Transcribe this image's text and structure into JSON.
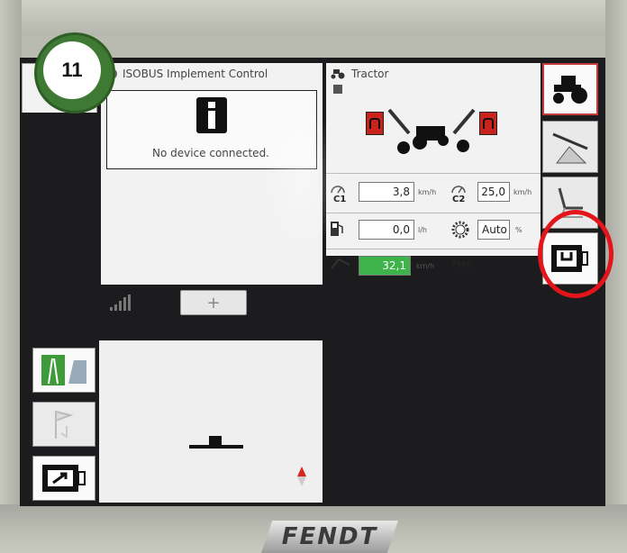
{
  "step_badge": "11",
  "isobus": {
    "title": "ISOBUS Implement Control",
    "message": "No device connected.",
    "plus_label": "+"
  },
  "tractor": {
    "title": "Tractor",
    "c1": {
      "label": "C1",
      "value": "3,8",
      "unit": "km/h"
    },
    "c2": {
      "label": "C2",
      "value": "25,0",
      "unit": "km/h"
    },
    "fuel": {
      "value": "0,0",
      "unit": "l/h"
    },
    "auto": {
      "value": "Auto",
      "unit": "%"
    },
    "tms": {
      "value": "32,1",
      "unit": "km/h",
      "label": "TMS"
    }
  },
  "right_tabs": [
    "tractor-icon",
    "sprayer-icon",
    "seat-icon",
    "terminal-settings-icon"
  ],
  "left_tabs": [
    "guidance-view-icon",
    "turn-sequence-icon",
    "terminal-fullscreen-icon"
  ],
  "brand": "FENDT",
  "colors": {
    "badge_green": "#3f7a34",
    "highlight_red": "#e3141a",
    "tms_green": "#3db34a",
    "lock_red": "#c9231c"
  }
}
